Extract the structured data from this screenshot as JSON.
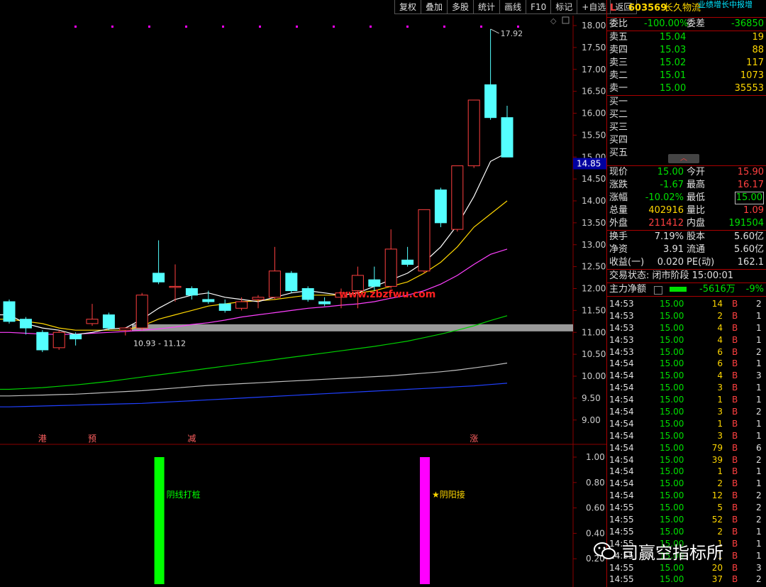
{
  "toolbar": [
    "复权",
    "叠加",
    "多股",
    "统计",
    "画线",
    "F10",
    "标记",
    "+自选",
    "返回"
  ],
  "stock": {
    "flag": "L",
    "code": "603569",
    "name": "长久物流",
    "marquee": "业绩增长中报增"
  },
  "order_book": {
    "committee_ratio_label": "委比",
    "committee_ratio": "-100.00%",
    "committee_diff_label": "委差",
    "committee_diff": "-36850",
    "asks": [
      {
        "label": "卖五",
        "price": "15.04",
        "vol": "19"
      },
      {
        "label": "卖四",
        "price": "15.03",
        "vol": "88"
      },
      {
        "label": "卖三",
        "price": "15.02",
        "vol": "117"
      },
      {
        "label": "卖二",
        "price": "15.01",
        "vol": "1073"
      },
      {
        "label": "卖一",
        "price": "15.00",
        "vol": "35553"
      }
    ],
    "bids": [
      {
        "label": "买一"
      },
      {
        "label": "买二"
      },
      {
        "label": "买三"
      },
      {
        "label": "买四"
      },
      {
        "label": "买五"
      }
    ]
  },
  "quote": [
    {
      "l1": "现价",
      "v1": "15.00",
      "c1": "green",
      "l2": "今开",
      "v2": "15.90",
      "c2": "red"
    },
    {
      "l1": "涨跌",
      "v1": "-1.67",
      "c1": "green",
      "l2": "最高",
      "v2": "16.17",
      "c2": "red"
    },
    {
      "l1": "涨幅",
      "v1": "-10.02%",
      "c1": "green",
      "l2": "最低",
      "v2": "15.00",
      "c2": "green"
    },
    {
      "l1": "总量",
      "v1": "402916",
      "c1": "yellow",
      "l2": "量比",
      "v2": "1.09",
      "c2": "red"
    },
    {
      "l1": "外盘",
      "v1": "211412",
      "c1": "red",
      "l2": "内盘",
      "v2": "191504",
      "c2": "green"
    }
  ],
  "fundamentals": [
    {
      "l1": "换手",
      "v1": "7.19%",
      "l2": "股本",
      "v2": "5.60亿"
    },
    {
      "l1": "净资",
      "v1": "3.91",
      "l2": "流通",
      "v2": "5.60亿"
    },
    {
      "l1": "收益(一)",
      "v1": "0.020",
      "l2": "PE(动)",
      "v2": "162.1"
    }
  ],
  "trade_status": "交易状态: 闭市阶段 15:00:01",
  "main_force": {
    "label": "主力净额",
    "amount": "-5616万",
    "pct": "-9%"
  },
  "ticks": [
    [
      "14:53",
      "15.00",
      "14",
      "B",
      "2"
    ],
    [
      "14:53",
      "15.00",
      "2",
      "B",
      "1"
    ],
    [
      "14:53",
      "15.00",
      "4",
      "B",
      "1"
    ],
    [
      "14:53",
      "15.00",
      "4",
      "B",
      "1"
    ],
    [
      "14:53",
      "15.00",
      "6",
      "B",
      "2"
    ],
    [
      "14:54",
      "15.00",
      "6",
      "B",
      "1"
    ],
    [
      "14:54",
      "15.00",
      "4",
      "B",
      "3"
    ],
    [
      "14:54",
      "15.00",
      "3",
      "B",
      "1"
    ],
    [
      "14:54",
      "15.00",
      "1",
      "B",
      "1"
    ],
    [
      "14:54",
      "15.00",
      "3",
      "B",
      "2"
    ],
    [
      "14:54",
      "15.00",
      "1",
      "B",
      "1"
    ],
    [
      "14:54",
      "15.00",
      "3",
      "B",
      "1"
    ],
    [
      "14:54",
      "15.00",
      "79",
      "B",
      "6"
    ],
    [
      "14:54",
      "15.00",
      "39",
      "B",
      "2"
    ],
    [
      "14:54",
      "15.00",
      "1",
      "B",
      "1"
    ],
    [
      "14:54",
      "15.00",
      "2",
      "B",
      "1"
    ],
    [
      "14:54",
      "15.00",
      "12",
      "B",
      "2"
    ],
    [
      "14:55",
      "15.00",
      "5",
      "B",
      "2"
    ],
    [
      "14:55",
      "15.00",
      "52",
      "B",
      "2"
    ],
    [
      "14:55",
      "15.00",
      "2",
      "B",
      "1"
    ],
    [
      "14:55",
      "15.00",
      "1",
      "B",
      "1"
    ],
    [
      "14:55",
      "15.00",
      "1",
      "B",
      "1"
    ],
    [
      "14:55",
      "15.00",
      "20",
      "B",
      "3"
    ],
    [
      "14:55",
      "15.00",
      "37",
      "B",
      "2"
    ]
  ],
  "chart_data": {
    "type": "candlestick",
    "y_ticks": [
      "18.00",
      "17.50",
      "17.00",
      "16.50",
      "16.00",
      "15.50",
      "15.00",
      "14.50",
      "14.00",
      "13.50",
      "13.00",
      "12.50",
      "12.00",
      "11.50",
      "11.00",
      "10.50",
      "10.00",
      "9.50",
      "9.00"
    ],
    "current_price_marker": "14.85",
    "high_label": "17.92",
    "support_band_label": "10.93 - 11.12",
    "watermark": "www.zbzfwu.com",
    "event_labels": [
      {
        "text": "港",
        "index": 2
      },
      {
        "text": "预",
        "index": 5
      },
      {
        "text": "减",
        "index": 11
      },
      {
        "text": "涨",
        "index": 28
      }
    ],
    "candles": [
      {
        "o": 11.7,
        "c": 11.25,
        "h": 11.75,
        "l": 11.2
      },
      {
        "o": 11.3,
        "c": 11.1,
        "h": 11.35,
        "l": 10.95
      },
      {
        "o": 11.0,
        "c": 10.6,
        "h": 11.05,
        "l": 10.55
      },
      {
        "o": 10.65,
        "c": 11.0,
        "h": 11.05,
        "l": 10.6
      },
      {
        "o": 10.95,
        "c": 10.85,
        "h": 11.0,
        "l": 10.7
      },
      {
        "o": 11.2,
        "c": 11.3,
        "h": 11.65,
        "l": 11.15
      },
      {
        "o": 11.4,
        "c": 11.1,
        "h": 11.45,
        "l": 11.05
      },
      {
        "o": 11.05,
        "c": 11.1,
        "h": 11.12,
        "l": 10.93
      },
      {
        "o": 11.1,
        "c": 11.85,
        "h": 11.9,
        "l": 11.05
      },
      {
        "o": 12.35,
        "c": 12.15,
        "h": 13.1,
        "l": 12.1
      },
      {
        "o": 12.05,
        "c": 12.05,
        "h": 12.55,
        "l": 11.7
      },
      {
        "o": 12.0,
        "c": 11.85,
        "h": 12.05,
        "l": 11.75
      },
      {
        "o": 11.75,
        "c": 11.7,
        "h": 11.95,
        "l": 11.65
      },
      {
        "o": 11.65,
        "c": 11.5,
        "h": 11.75,
        "l": 11.45
      },
      {
        "o": 11.55,
        "c": 11.7,
        "h": 11.8,
        "l": 11.5
      },
      {
        "o": 11.75,
        "c": 11.8,
        "h": 11.85,
        "l": 11.55
      },
      {
        "o": 11.8,
        "c": 12.4,
        "h": 12.95,
        "l": 11.75
      },
      {
        "o": 12.35,
        "c": 11.95,
        "h": 12.4,
        "l": 11.9
      },
      {
        "o": 12.0,
        "c": 11.75,
        "h": 12.05,
        "l": 11.7
      },
      {
        "o": 11.7,
        "c": 11.65,
        "h": 11.8,
        "l": 11.6
      },
      {
        "o": 11.8,
        "c": 11.9,
        "h": 12.0,
        "l": 11.55
      },
      {
        "o": 11.95,
        "c": 12.3,
        "h": 12.5,
        "l": 11.55
      },
      {
        "o": 12.2,
        "c": 12.05,
        "h": 12.5,
        "l": 11.95
      },
      {
        "o": 12.05,
        "c": 12.9,
        "h": 13.35,
        "l": 12.0
      },
      {
        "o": 12.65,
        "c": 12.55,
        "h": 12.95,
        "l": 12.5
      },
      {
        "o": 12.4,
        "c": 13.8,
        "h": 13.8,
        "l": 12.35
      },
      {
        "o": 14.25,
        "c": 13.5,
        "h": 14.3,
        "l": 13.4
      },
      {
        "o": 13.35,
        "c": 14.8,
        "h": 14.8,
        "l": 13.3
      },
      {
        "o": 14.8,
        "c": 16.3,
        "h": 16.3,
        "l": 14.75
      },
      {
        "o": 16.65,
        "c": 15.9,
        "h": 17.92,
        "l": 15.85
      },
      {
        "o": 15.9,
        "c": 15.0,
        "h": 16.17,
        "l": 15.0
      }
    ],
    "ma5": [
      11.4,
      11.2,
      11.1,
      11.05,
      10.95,
      11.0,
      11.08,
      11.1,
      11.3,
      11.55,
      11.75,
      11.85,
      11.9,
      11.8,
      11.75,
      11.7,
      11.8,
      11.9,
      11.95,
      11.9,
      11.85,
      11.9,
      12.05,
      12.2,
      12.35,
      12.6,
      12.95,
      13.45,
      14.1,
      14.9,
      15.1
    ],
    "ma10": [
      11.3,
      11.25,
      11.2,
      11.1,
      11.05,
      11.05,
      11.05,
      11.05,
      11.15,
      11.3,
      11.4,
      11.5,
      11.6,
      11.65,
      11.7,
      11.72,
      11.75,
      11.8,
      11.85,
      11.85,
      11.85,
      11.9,
      11.95,
      12.05,
      12.15,
      12.35,
      12.6,
      12.95,
      13.4,
      13.7,
      14.0
    ],
    "ma20": [
      11.0,
      10.98,
      10.96,
      10.95,
      10.96,
      10.98,
      11.0,
      11.02,
      11.05,
      11.08,
      11.12,
      11.18,
      11.22,
      11.28,
      11.35,
      11.4,
      11.45,
      11.5,
      11.55,
      11.58,
      11.62,
      11.65,
      11.7,
      11.78,
      11.85,
      11.95,
      12.1,
      12.3,
      12.55,
      12.78,
      12.9
    ],
    "ma60": [
      9.7,
      9.72,
      9.74,
      9.77,
      9.8,
      9.84,
      9.88,
      9.93,
      9.98,
      10.03,
      10.08,
      10.13,
      10.18,
      10.23,
      10.28,
      10.33,
      10.38,
      10.43,
      10.48,
      10.53,
      10.58,
      10.63,
      10.68,
      10.74,
      10.8,
      10.88,
      10.96,
      11.05,
      11.15,
      11.27,
      11.38
    ],
    "ma120": [
      9.55,
      9.56,
      9.57,
      9.58,
      9.59,
      9.61,
      9.63,
      9.65,
      9.67,
      9.7,
      9.73,
      9.76,
      9.79,
      9.81,
      9.83,
      9.85,
      9.87,
      9.89,
      9.91,
      9.93,
      9.95,
      9.97,
      9.99,
      10.01,
      10.04,
      10.07,
      10.1,
      10.14,
      10.19,
      10.24,
      10.3
    ],
    "ma250": [
      9.3,
      9.31,
      9.32,
      9.33,
      9.34,
      9.35,
      9.36,
      9.37,
      9.38,
      9.4,
      9.42,
      9.44,
      9.46,
      9.48,
      9.5,
      9.52,
      9.54,
      9.56,
      9.58,
      9.6,
      9.62,
      9.64,
      9.66,
      9.68,
      9.7,
      9.72,
      9.74,
      9.76,
      9.78,
      9.81,
      9.84
    ],
    "lower_ticks": [
      "1.00",
      "0.80",
      "0.60",
      "0.40",
      "0.20"
    ],
    "signals": [
      {
        "index": 9,
        "value": 1.0,
        "label": "阴线打桩",
        "color": "#00ff00",
        "label_color": "#00ff00"
      },
      {
        "index": 25,
        "value": 1.0,
        "label": "★阴阳接",
        "color": "#ff00ff",
        "label_color": "#ffd700"
      }
    ],
    "colors": {
      "up": "#ff4040",
      "down": "#54ffff",
      "ma5": "#ffffff",
      "ma10": "#ffd700",
      "ma20": "#ff40ff",
      "ma60": "#00d000",
      "ma120": "#c0c0c0",
      "ma250": "#2040ff",
      "band": "#9a9a9a",
      "grid": "#8b0000"
    }
  },
  "watermark_account": "司赢空指标所"
}
